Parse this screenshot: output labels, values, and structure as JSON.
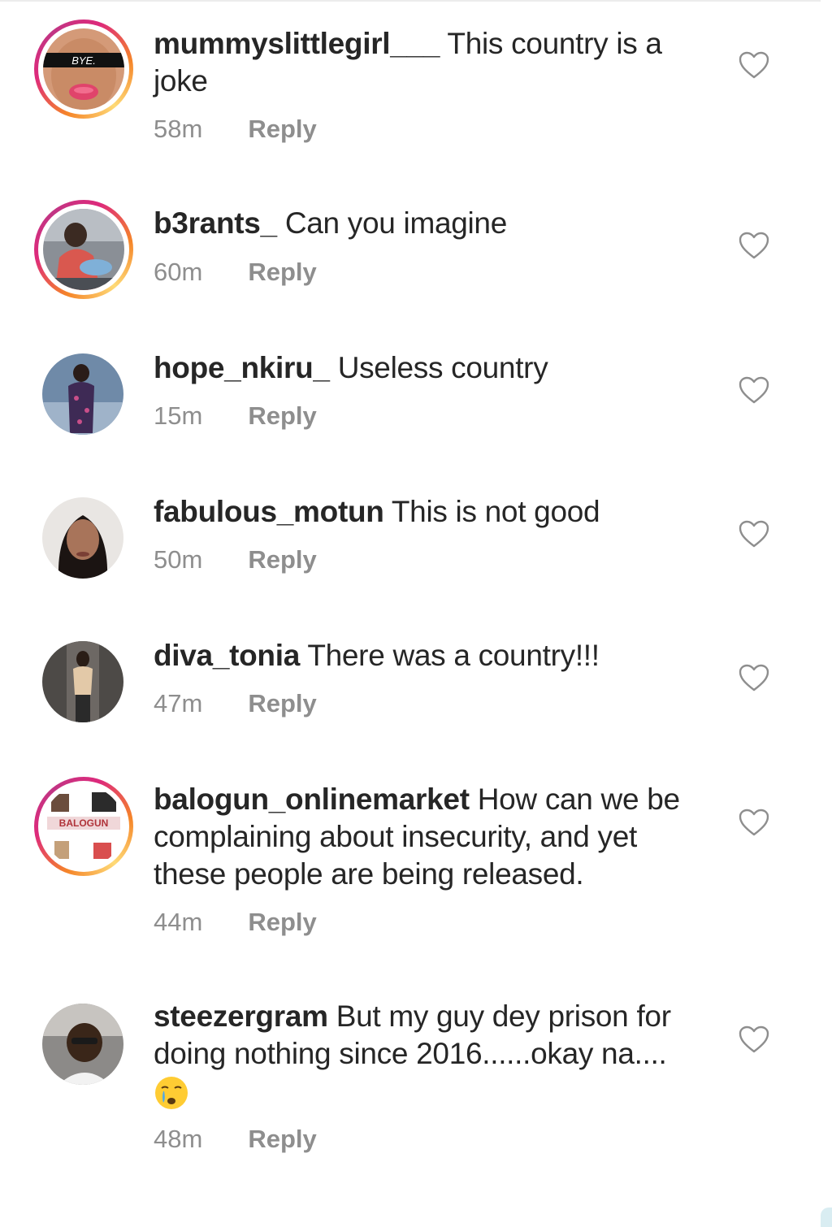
{
  "comments": [
    {
      "username": "mummyslittlegirl___",
      "text": "This country is a joke",
      "time": "58m",
      "reply_label": "Reply",
      "avatar_label": "BYE."
    },
    {
      "username": "b3rants_",
      "text": "Can you imagine",
      "time": "60m",
      "reply_label": "Reply"
    },
    {
      "username": "hope_nkiru_",
      "text": "Useless country",
      "time": "15m",
      "reply_label": "Reply"
    },
    {
      "username": "fabulous_motun",
      "text": "This is not good",
      "time": "50m",
      "reply_label": "Reply"
    },
    {
      "username": "diva_tonia",
      "text": "There was a country!!!",
      "time": "47m",
      "reply_label": "Reply"
    },
    {
      "username": "balogun_onlinemarket",
      "text": "How can we be complaining about insecurity, and yet these people are being released.",
      "time": "44m",
      "reply_label": "Reply",
      "avatar_label": "BALOGUN"
    },
    {
      "username": "steezergram",
      "text": "But my guy dey prison for doing nothing since 2016......okay na....",
      "time": "48m",
      "reply_label": "Reply",
      "emoji": "crying-face-emoji"
    }
  ],
  "icons": {
    "like": "heart-outline-icon"
  },
  "colors": {
    "text": "#262626",
    "meta": "#8e8e8e",
    "story_ring_start": "#f58529",
    "story_ring_end": "#dd2a7b"
  }
}
